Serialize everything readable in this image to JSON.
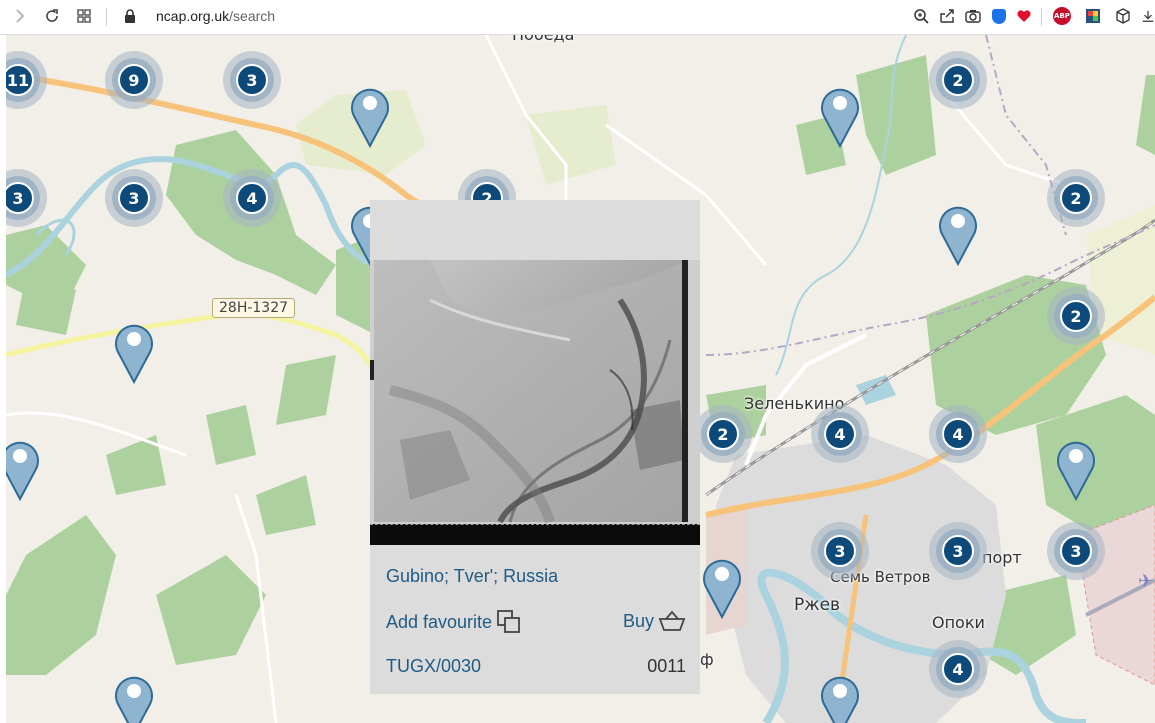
{
  "browser": {
    "url_host": "ncap.org.uk",
    "url_path": "/search",
    "extensions": [
      "zoom-icon",
      "share-icon",
      "camera-icon",
      "shield-extension-icon",
      "heart-icon",
      "adblock-plus-icon",
      "extension-icon",
      "cube-icon"
    ],
    "abp_label": "ABP"
  },
  "map": {
    "road_shield": "28H-1327",
    "place_labels": {
      "pobeda": "Победа",
      "zelenkino": "Зеленькино",
      "sem_vetrov": "Семь Ветров",
      "rzhev": "Ржев",
      "opoki": "Опоки",
      "aeroport": "порт",
      "f": "ф"
    },
    "clusters": [
      {
        "count": "11"
      },
      {
        "count": "9"
      },
      {
        "count": "3"
      },
      {
        "count": "2"
      },
      {
        "count": "3"
      },
      {
        "count": "3"
      },
      {
        "count": "4"
      },
      {
        "count": "2"
      },
      {
        "count": "2"
      },
      {
        "count": "2"
      },
      {
        "count": "2"
      },
      {
        "count": "4"
      },
      {
        "count": "4"
      },
      {
        "count": "3"
      },
      {
        "count": "3"
      },
      {
        "count": "3"
      },
      {
        "count": "4"
      }
    ]
  },
  "popup": {
    "place": "Gubino; Tver'; Russia",
    "add_favourite": "Add favourite",
    "buy": "Buy",
    "reference": "TUGX/0030",
    "frame": "0011"
  },
  "colors": {
    "cluster_core": "#0d4a7a",
    "pin": "#8fb4d0",
    "link_text": "#1f5b86",
    "forest": "#add19e",
    "road_main": "#f7c37a"
  }
}
